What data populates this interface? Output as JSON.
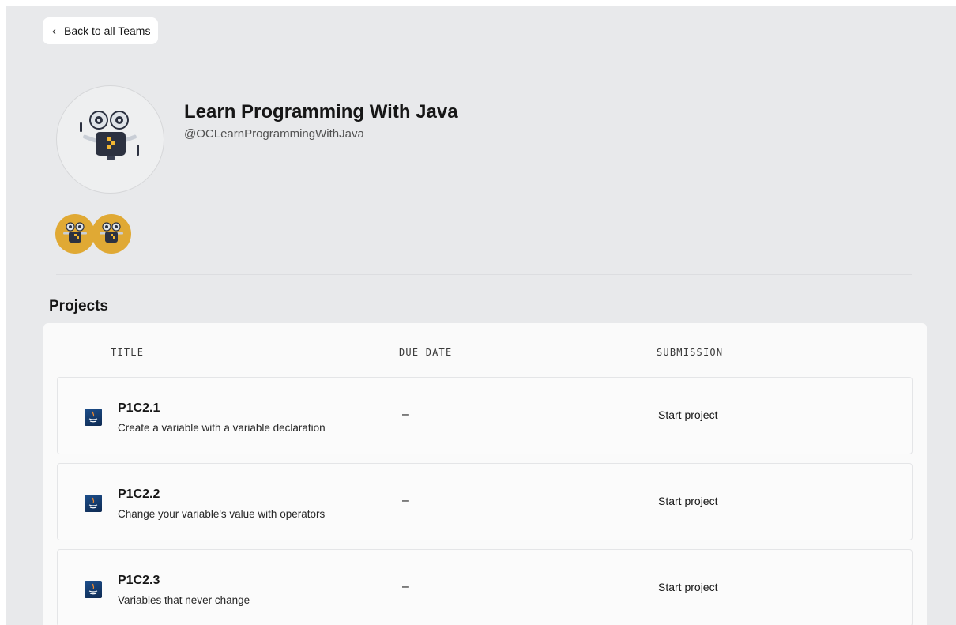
{
  "back_button": {
    "label": "Back to all Teams"
  },
  "team": {
    "name": "Learn Programming With Java",
    "handle": "@OCLearnProgrammingWithJava"
  },
  "members": [
    {
      "icon": "robot-avatar-icon"
    },
    {
      "icon": "robot-avatar-icon"
    }
  ],
  "projects": {
    "section_title": "Projects",
    "columns": {
      "title": "TITLE",
      "due_date": "DUE DATE",
      "submission": "SUBMISSION"
    },
    "rows": [
      {
        "icon": "java-logo-icon",
        "title": "P1C2.1",
        "description": "Create a variable with a variable declaration",
        "due_date": "–",
        "submission": "Start project"
      },
      {
        "icon": "java-logo-icon",
        "title": "P1C2.2",
        "description": "Change your variable's value with operators",
        "due_date": "–",
        "submission": "Start project"
      },
      {
        "icon": "java-logo-icon",
        "title": "P1C2.3",
        "description": "Variables that never change",
        "due_date": "–",
        "submission": "Start project"
      }
    ]
  },
  "colors": {
    "page_background": "#e8e9eb",
    "member_avatar": "#e0a934",
    "robot_body": "#2c3140",
    "robot_accent": "#f2b632"
  }
}
